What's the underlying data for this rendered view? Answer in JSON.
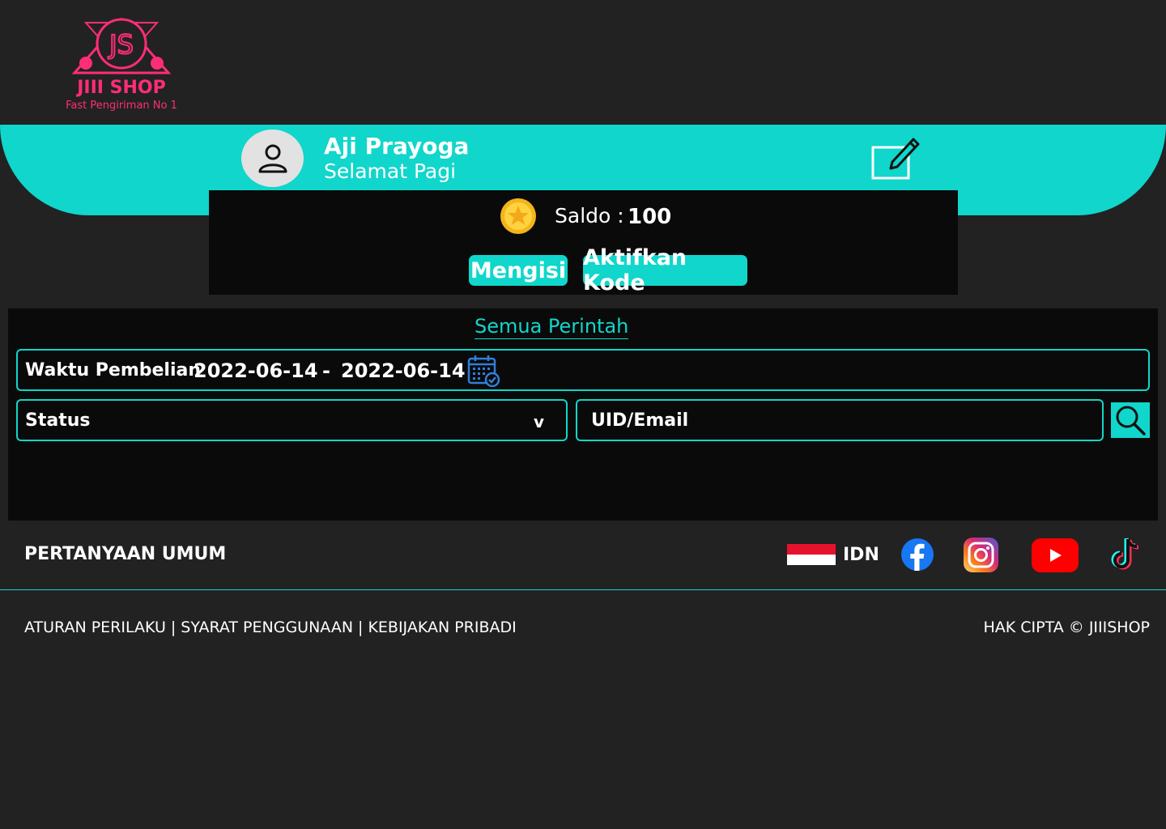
{
  "logo": {
    "monogram": "JS",
    "brand": "JIII SHOP",
    "tagline": "Fast Pengiriman No 1",
    "color": "#ff2d78"
  },
  "profile": {
    "name": "Aji Prayoga",
    "greeting": "Selamat Pagi",
    "avatar_icon": "user-icon",
    "edit_icon": "edit-icon"
  },
  "wallet": {
    "balance_label": "Saldo :",
    "balance_value": "100",
    "coin_icon": "coin-star-icon",
    "topup_label": "Mengisi",
    "activate_code_label": "Aktifkan Kode"
  },
  "orders": {
    "tab_label": "Semua Perintah",
    "date_filter": {
      "label": "Waktu Pembelian",
      "from": "2022-06-14",
      "separator": "-",
      "to": "2022-06-14",
      "icon": "calendar-icon"
    },
    "status_filter": {
      "label": "Status",
      "caret": "v"
    },
    "uid_search": {
      "placeholder": "UID/Email",
      "icon": "search-icon"
    }
  },
  "footer": {
    "faq_label": "PERTANYAAN UMUM",
    "language": "IDN",
    "social": [
      "facebook-icon",
      "instagram-icon",
      "youtube-icon",
      "tiktok-icon"
    ],
    "legal_links": [
      "ATURAN PERILAKU",
      "SYARAT PENGGUNAAN",
      "KEBIJAKAN PRIBADI"
    ],
    "link_separator": "|",
    "copyright": "HAK CIPTA © JIIISHOP"
  },
  "colors": {
    "background": "#222222",
    "panel": "#0a0a0a",
    "accent": "#10d6cb",
    "brand": "#ff2d78"
  }
}
